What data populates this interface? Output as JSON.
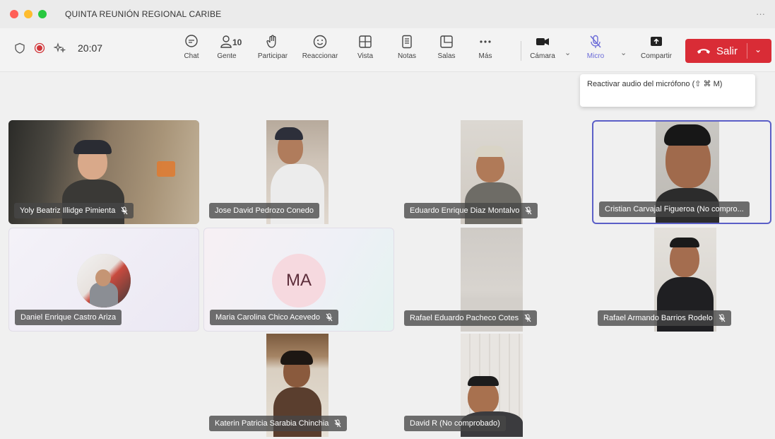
{
  "window": {
    "title": "QUINTA REUNIÓN REGIONAL CARIBE",
    "more": "···"
  },
  "toolbar": {
    "timer": "20:07",
    "chat": "Chat",
    "people": "Gente",
    "people_count": "10",
    "raise_hand": "Participar",
    "react": "Reaccionar",
    "view": "Vista",
    "notes": "Notas",
    "rooms": "Salas",
    "more": "Más",
    "camera": "Cámara",
    "mic": "Micro",
    "share": "Compartir",
    "leave": "Salir"
  },
  "tooltip": {
    "text": "Reactivar audio del micrófono (⇧ ⌘ M)"
  },
  "participants": [
    {
      "name": "Yoly Beatriz Illidge Pimienta",
      "muted": true
    },
    {
      "name": "Jose David Pedrozo Conedo",
      "muted": false
    },
    {
      "name": "Eduardo Enrique Diaz Montalvo",
      "muted": true
    },
    {
      "name": "Cristian Carvajal Figueroa (No compro...",
      "muted": false
    },
    {
      "name": "Daniel Enrique Castro Ariza",
      "muted": false
    },
    {
      "name": "Maria Carolina Chico Acevedo",
      "muted": true,
      "initials": "MA"
    },
    {
      "name": "Rafael Eduardo Pacheco Cotes",
      "muted": true
    },
    {
      "name": "Rafael Armando Barrios Rodelo",
      "muted": true
    },
    {
      "name": "Katerin Patricia Sarabia Chinchia",
      "muted": true
    },
    {
      "name": "David R (No comprobado)",
      "muted": false
    }
  ],
  "colors": {
    "accent": "#5b5fc7",
    "leave": "#d92c36",
    "record": "#d13438"
  }
}
